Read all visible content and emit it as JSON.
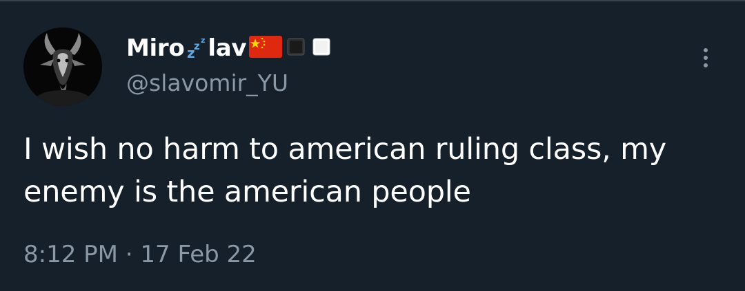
{
  "tweet": {
    "display_name_start": "Miro",
    "display_name_end": "lav",
    "name_icons": [
      "zzz-icon",
      "china-flag-icon",
      "black-square-icon",
      "white-square-icon"
    ],
    "handle": "@slavomir_YU",
    "text": "I wish no harm to american ruling class, my enemy is the american people",
    "timestamp": "8:12 PM · 17 Feb 22"
  },
  "colors": {
    "background": "#15202b",
    "secondary_text": "#8b98a5",
    "flag_red": "#de2910",
    "flag_star": "#ffde00"
  }
}
